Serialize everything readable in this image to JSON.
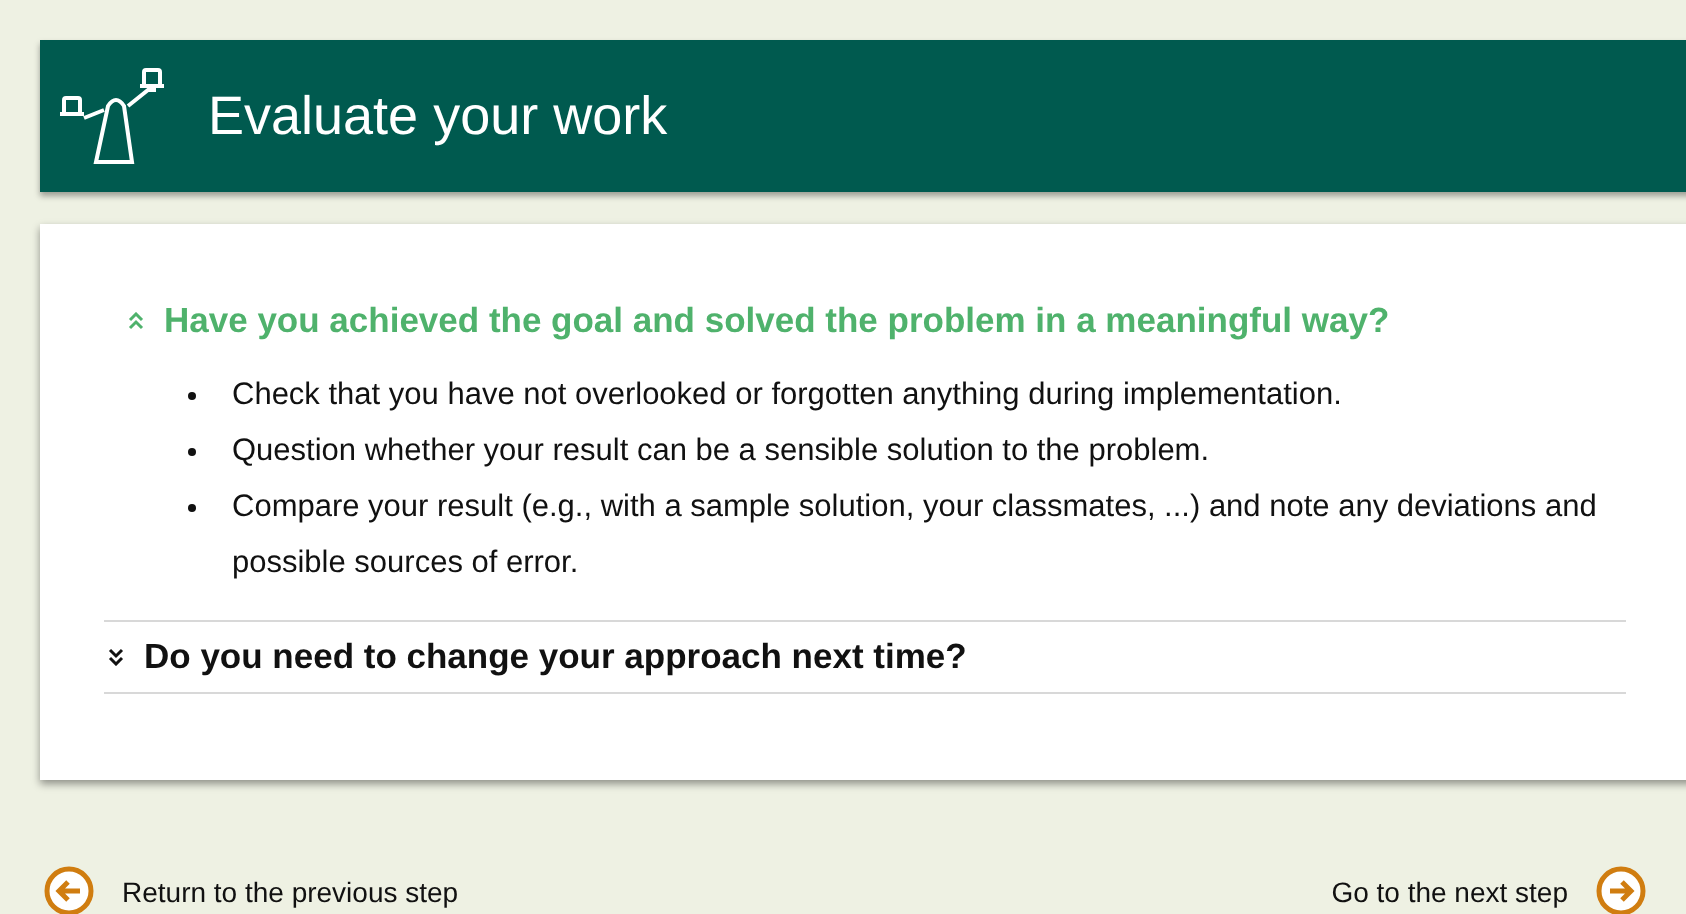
{
  "header": {
    "title": "Evaluate your work"
  },
  "sections": [
    {
      "title": "Have you achieved the goal and solved the problem in a meaningful way?",
      "expanded": true,
      "items": [
        "Check that you have not overlooked or forgotten anything during implementation.",
        "Question whether your result can be a sensible solution to the problem.",
        "Compare your result (e.g., with a sample solution, your classmates, ...) and note any deviations and possible sources of error."
      ]
    },
    {
      "title": "Do you need to change your approach next time?",
      "expanded": false
    }
  ],
  "footer": {
    "previous": "Return to the previous step",
    "next": "Go to the next step"
  }
}
